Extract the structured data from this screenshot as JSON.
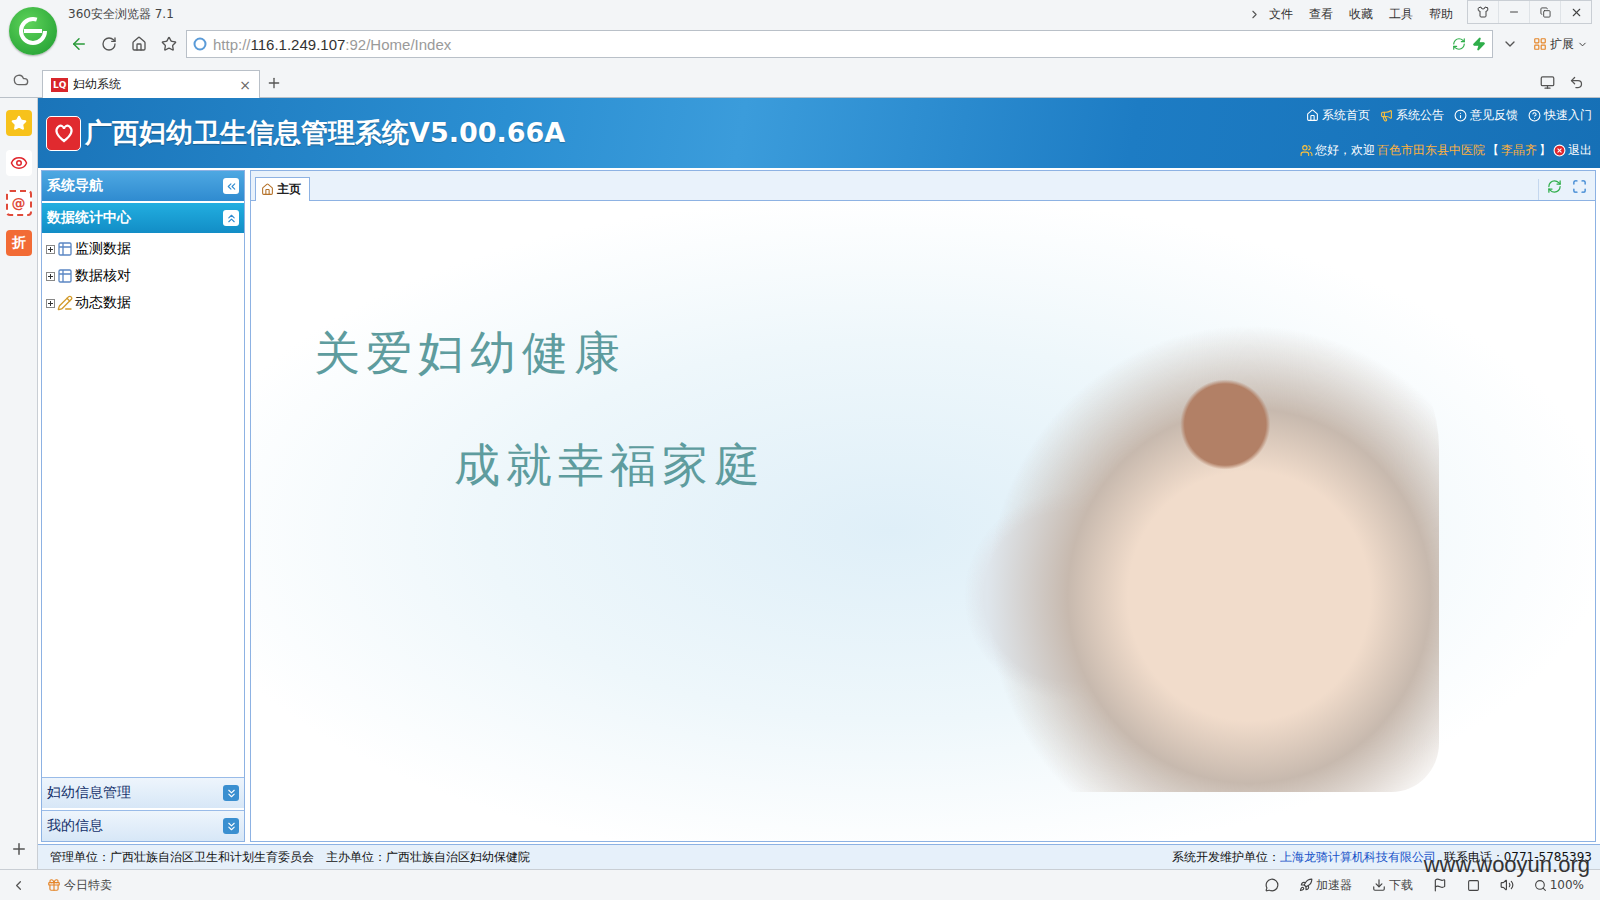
{
  "browser": {
    "title": "360安全浏览器 7.1",
    "menu": [
      "文件",
      "查看",
      "收藏",
      "工具",
      "帮助"
    ],
    "url": [
      {
        "text": "http://",
        "dim": true
      },
      {
        "text": "116.1.249.107",
        "dim": false
      },
      {
        "text": ":92/Home/Index",
        "dim": true
      }
    ],
    "extension": "扩展",
    "tabs": [
      {
        "favicon": "LQ",
        "label": "妇幼系统",
        "close": "×",
        "selected": true
      }
    ],
    "side_icons": [
      {
        "text": ""
      },
      {
        "text": ""
      },
      {
        "text": "@"
      },
      {
        "text": "折"
      }
    ]
  },
  "page": {
    "title": "广西妇幼卫生信息管理系统V5.00.66A",
    "links": [
      "系统首页",
      "系统公告",
      "意见反馈",
      "快速入门"
    ],
    "welcome": {
      "prefix": "您好，欢迎",
      "org": "百色市田东县中医院",
      "name_open": "【",
      "name": "李晶齐",
      "name_close": "】",
      "logout": "退出"
    },
    "nav": {
      "title": "系统导航",
      "sections": [
        {
          "label": "数据统计中心",
          "expanded": true,
          "items": [
            {
              "label": "监测数据",
              "expanded": false
            },
            {
              "label": "数据核对",
              "expanded": false
            },
            {
              "label": "动态数据",
              "expanded": false
            }
          ]
        },
        {
          "label": "妇幼信息管理",
          "expanded": false,
          "items": []
        },
        {
          "label": "我的信息",
          "expanded": false,
          "items": []
        }
      ]
    },
    "content_tabs": [
      {
        "label": "主页",
        "selected": true
      }
    ],
    "banner": {
      "slogans": [
        "关爱妇幼健康",
        "成就幸福家庭"
      ]
    },
    "footer": {
      "manager": "管理单位：广西壮族自治区卫生和计划生育委员会",
      "host": "主办单位：广西壮族自治区妇幼保健院",
      "developer_label": "系统开发维护单位：",
      "developer": "上海龙骑计算机科技有限公司",
      "phone": "联系电话：0771-5785393"
    }
  },
  "status_bar": {
    "left": "今日特卖",
    "items": [
      "加速器",
      "下载"
    ],
    "zoom": "100%"
  },
  "watermark": "www.wooyun.org"
}
